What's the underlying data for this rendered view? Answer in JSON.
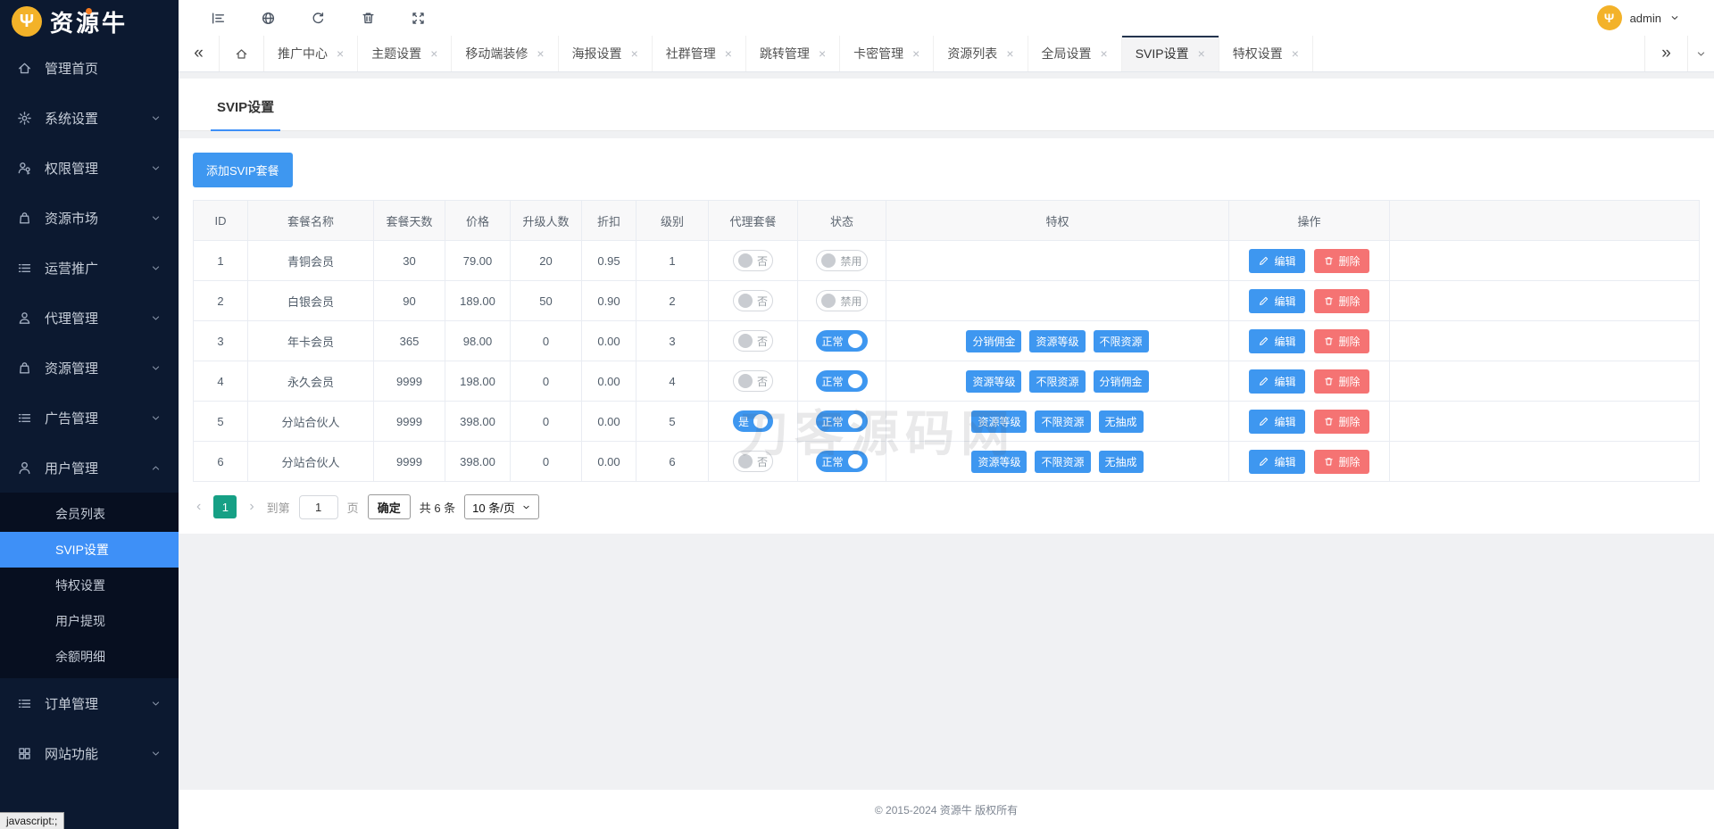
{
  "brand": {
    "name": "资源牛"
  },
  "user": {
    "name": "admin"
  },
  "topbar": {
    "icons": [
      {
        "name": "menu-fold-icon"
      },
      {
        "name": "globe-icon"
      },
      {
        "name": "refresh-icon"
      },
      {
        "name": "trash-icon"
      },
      {
        "name": "fullscreen-icon"
      }
    ]
  },
  "tabbar": {
    "collapse_left": "«",
    "collapse_right": "»",
    "close_glyph": "×",
    "tabs": [
      {
        "label": "推广中心",
        "active": false
      },
      {
        "label": "主题设置",
        "active": false
      },
      {
        "label": "移动端装修",
        "active": false
      },
      {
        "label": "海报设置",
        "active": false
      },
      {
        "label": "社群管理",
        "active": false
      },
      {
        "label": "跳转管理",
        "active": false
      },
      {
        "label": "卡密管理",
        "active": false
      },
      {
        "label": "资源列表",
        "active": false
      },
      {
        "label": "全局设置",
        "active": false
      },
      {
        "label": "SVIP设置",
        "active": true
      },
      {
        "label": "特权设置",
        "active": false
      }
    ]
  },
  "sidebar": {
    "items": [
      {
        "label": "管理首页",
        "icon": "home-icon"
      },
      {
        "label": "系统设置",
        "icon": "gear-icon",
        "chevron": "down"
      },
      {
        "label": "权限管理",
        "icon": "key-icon",
        "chevron": "down"
      },
      {
        "label": "资源市场",
        "icon": "bag-icon",
        "chevron": "down"
      },
      {
        "label": "运营推广",
        "icon": "list-icon",
        "chevron": "down"
      },
      {
        "label": "代理管理",
        "icon": "agent-icon",
        "chevron": "down"
      },
      {
        "label": "资源管理",
        "icon": "bag-icon",
        "chevron": "down"
      },
      {
        "label": "广告管理",
        "icon": "list-icon",
        "chevron": "down"
      },
      {
        "label": "用户管理",
        "icon": "user-icon",
        "chevron": "up",
        "children": [
          {
            "label": "会员列表",
            "active": false
          },
          {
            "label": "SVIP设置",
            "active": true
          },
          {
            "label": "特权设置",
            "active": false
          },
          {
            "label": "用户提现",
            "active": false
          },
          {
            "label": "余额明细",
            "active": false
          }
        ]
      },
      {
        "label": "订单管理",
        "icon": "list-icon",
        "chevron": "down"
      },
      {
        "label": "网站功能",
        "icon": "grid-icon",
        "chevron": "down"
      }
    ]
  },
  "page": {
    "tab_title": "SVIP设置",
    "add_button_label": "添加SVIP套餐"
  },
  "table": {
    "columns": [
      "ID",
      "套餐名称",
      "套餐天数",
      "价格",
      "升级人数",
      "折扣",
      "级别",
      "代理套餐",
      "状态",
      "特权",
      "操作",
      ""
    ],
    "actions": {
      "edit": "编辑",
      "delete": "删除"
    },
    "rows": [
      {
        "id": "1",
        "name": "青铜会员",
        "days": "30",
        "price": "79.00",
        "upgrade": "20",
        "discount": "0.95",
        "level": "1",
        "agent": {
          "label": "否",
          "on": false
        },
        "status": {
          "label": "禁用",
          "on": false
        },
        "privileges": []
      },
      {
        "id": "2",
        "name": "白银会员",
        "days": "90",
        "price": "189.00",
        "upgrade": "50",
        "discount": "0.90",
        "level": "2",
        "agent": {
          "label": "否",
          "on": false
        },
        "status": {
          "label": "禁用",
          "on": false
        },
        "privileges": []
      },
      {
        "id": "3",
        "name": "年卡会员",
        "days": "365",
        "price": "98.00",
        "upgrade": "0",
        "discount": "0.00",
        "level": "3",
        "agent": {
          "label": "否",
          "on": false
        },
        "status": {
          "label": "正常",
          "on": true
        },
        "privileges": [
          "分销佣金",
          "资源等级",
          "不限资源"
        ]
      },
      {
        "id": "4",
        "name": "永久会员",
        "days": "9999",
        "price": "198.00",
        "upgrade": "0",
        "discount": "0.00",
        "level": "4",
        "agent": {
          "label": "否",
          "on": false
        },
        "status": {
          "label": "正常",
          "on": true
        },
        "privileges": [
          "资源等级",
          "不限资源",
          "分销佣金"
        ]
      },
      {
        "id": "5",
        "name": "分站合伙人",
        "days": "9999",
        "price": "398.00",
        "upgrade": "0",
        "discount": "0.00",
        "level": "5",
        "agent": {
          "label": "是",
          "on": true
        },
        "status": {
          "label": "正常",
          "on": true
        },
        "privileges": [
          "资源等级",
          "不限资源",
          "无抽成"
        ]
      },
      {
        "id": "6",
        "name": "分站合伙人",
        "days": "9999",
        "price": "398.00",
        "upgrade": "0",
        "discount": "0.00",
        "level": "6",
        "agent": {
          "label": "否",
          "on": false
        },
        "status": {
          "label": "正常",
          "on": true
        },
        "privileges": [
          "资源等级",
          "不限资源",
          "无抽成"
        ]
      }
    ]
  },
  "pagination": {
    "prev": "‹",
    "current": "1",
    "next": "›",
    "goto_prefix": "到第",
    "goto_value": "1",
    "goto_suffix": "页",
    "confirm": "确定",
    "total": "共 6 条",
    "page_size": "10 条/页"
  },
  "footer": {
    "copyright": "© 2015-2024 资源牛 版权所有"
  },
  "watermark": {
    "text": "刀客源码网"
  },
  "status_bar": {
    "text": "javascript:;"
  }
}
